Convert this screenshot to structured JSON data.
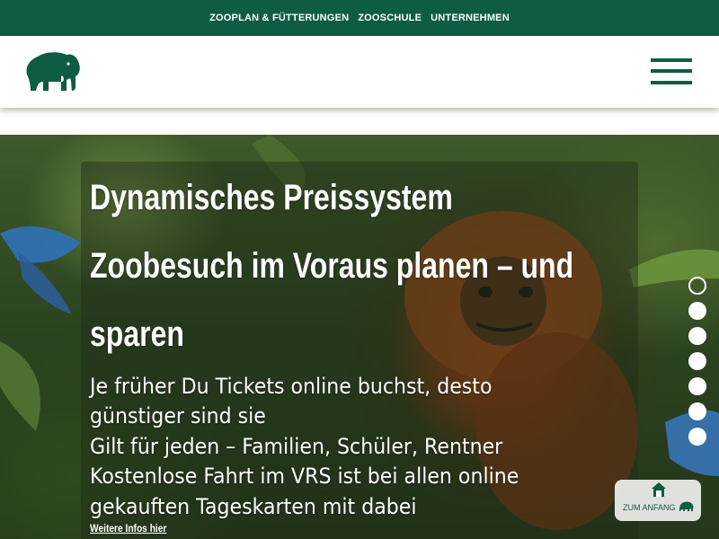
{
  "topnav": {
    "items": [
      {
        "label": "ZOOPLAN & FÜTTERUNGEN"
      },
      {
        "label": "ZOOSCHULE"
      },
      {
        "label": "UNTERNEHMEN"
      }
    ]
  },
  "header": {
    "logo_icon": "elephant-logo-icon",
    "menu_icon": "hamburger-menu-icon"
  },
  "hero": {
    "title_line1": "Dynamisches Preissystem",
    "title_line2": "Zoobesuch im Voraus planen – und",
    "title_line3": "sparen",
    "text_line1": "Je früher Du Tickets online buchst, desto",
    "text_line2": "günstiger sind sie",
    "text_line3": "Gilt für jeden – Familien, Schüler, Rentner",
    "text_line4": "Kostenlose Fahrt im VRS ist bei allen online",
    "text_line5": "gekauften Tageskarten mit dabei",
    "more_link": "Weitere Infos hier"
  },
  "slider": {
    "slide_count": 7,
    "active_index": 0
  },
  "to_top": {
    "label": "ZUM ANFANG",
    "icon": "house-icon"
  },
  "colors": {
    "brand_green": "#0d5c43",
    "text_light": "#ffffff"
  }
}
